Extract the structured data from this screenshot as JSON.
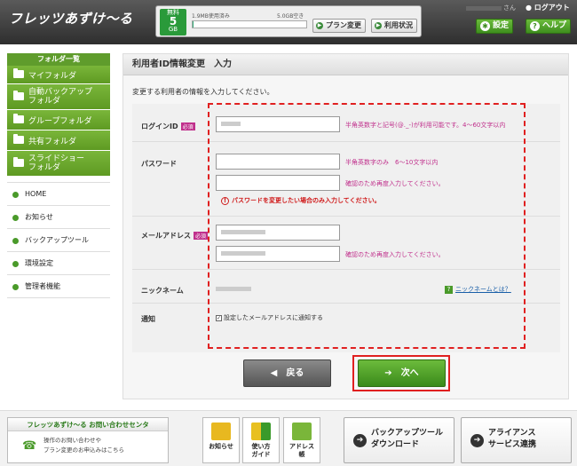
{
  "header": {
    "logo_main": "フレッツあずけ〜る",
    "plan_badge": {
      "top": "無料",
      "num": "5",
      "unit": "GB"
    },
    "usage_used": "1.9MB使用済み",
    "usage_free": "5.0GB空き",
    "usage_fraction": 0.0004,
    "plan_change": "プラン変更",
    "usage_status": "利用状況",
    "user_suffix": "さん",
    "logout": "ログアウト",
    "settings": "設定",
    "help": "ヘルプ"
  },
  "sidebar": {
    "folder_heading": "フォルダ一覧",
    "folders": [
      {
        "label": "マイフォルダ"
      },
      {
        "label": "自動バックアップ\nフォルダ"
      },
      {
        "label": "グループフォルダ"
      },
      {
        "label": "共有フォルダ"
      },
      {
        "label": "スライドショー\nフォルダ"
      }
    ],
    "nav": [
      {
        "label": "HOME"
      },
      {
        "label": "お知らせ"
      },
      {
        "label": "バックアップツール"
      },
      {
        "label": "環境設定"
      },
      {
        "label": "管理者機能"
      }
    ]
  },
  "main": {
    "title": "利用者ID情報変更　入力",
    "description": "変更する利用者の情報を入力してください。",
    "required": "必須",
    "login_id_label": "ログインID",
    "login_id_hint": "半角英数字と記号(@._-)が利用可能です。4〜60文字以内",
    "password_label": "パスワード",
    "password_hint": "半角英数字のみ　6〜10文字以内",
    "password_confirm_hint": "確認のため再度入力してください。",
    "password_warning": "パスワードを変更したい場合のみ入力してください。",
    "email_label": "メールアドレス",
    "email_confirm_hint": "確認のため再度入力してください。",
    "nickname_label": "ニックネーム",
    "nickname_help": "ニックネームとは？",
    "notify_label": "通知",
    "notify_option": "設定したメールアドレスに通知する",
    "back_button": "戻る",
    "next_button": "次へ"
  },
  "footer": {
    "contact_title": "フレッツあずけ〜る お問い合わせセンタ",
    "contact_line1": "操作のお問い合わせや",
    "contact_line2": "プラン変更のお申込みはこちら",
    "notice": "お知らせ",
    "guide": "使い方\nガイド",
    "address_book": "アドレス\n帳",
    "backup_download": "バックアップツール\nダウンロード",
    "alliance": "アライアンス\nサービス連携"
  }
}
